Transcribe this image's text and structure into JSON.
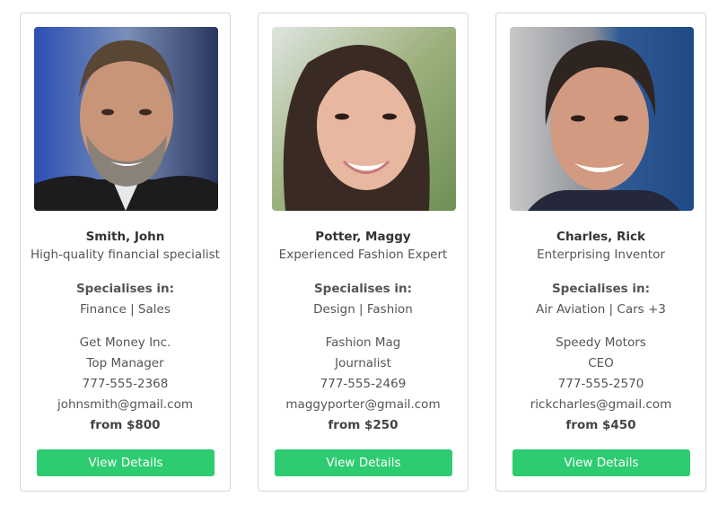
{
  "button_color": "#2ecc71",
  "specialises_label": "Specialises in:",
  "cards": [
    {
      "name": "Smith, John",
      "title": "High-quality financial specialist",
      "specialities": "Finance | Sales",
      "company": "Get Money Inc.",
      "position": "Top Manager",
      "phone": "777-555-2368",
      "email": "johnsmith@gmail.com",
      "price": "from $800",
      "button_label": "View Details",
      "photo": "portrait-photo-man-grey-beard"
    },
    {
      "name": "Potter, Maggy",
      "title": "Experienced Fashion Expert",
      "specialities": "Design | Fashion",
      "company": "Fashion Mag",
      "position": "Journalist",
      "phone": "777-555-2469",
      "email": "maggyporter@gmail.com",
      "price": "from $250",
      "button_label": "View Details",
      "photo": "portrait-photo-woman-long-hair"
    },
    {
      "name": "Charles, Rick",
      "title": "Enterprising Inventor",
      "specialities": "Air Aviation | Cars +3",
      "company": "Speedy Motors",
      "position": "CEO",
      "phone": "777-555-2570",
      "email": "rickcharles@gmail.com",
      "price": "from $450",
      "button_label": "View Details",
      "photo": "portrait-photo-man-dark-hair"
    }
  ]
}
